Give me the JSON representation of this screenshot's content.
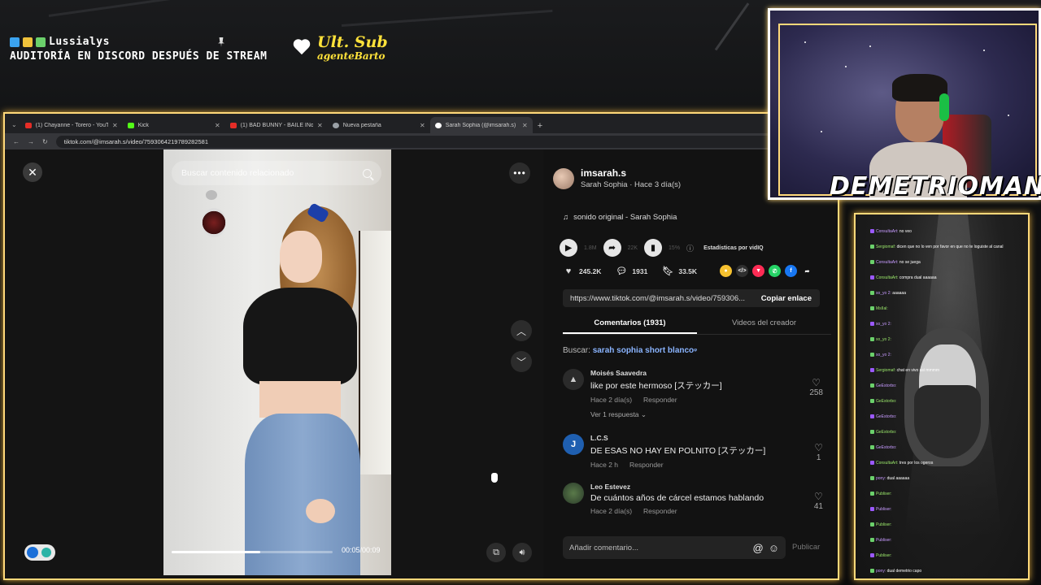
{
  "overlay": {
    "user_line": "Lussialys",
    "announcement": "AUDITORÍA EN DISCORD DESPUÉS DE STREAM",
    "last_sub_title": "Ult. Sub",
    "last_sub_name": "agenteBarto"
  },
  "browser": {
    "tabs": [
      {
        "label": "(1) Chayanne - Torero - YouTube",
        "color": "#e52d27"
      },
      {
        "label": "Kick",
        "color": "#53fc18"
      },
      {
        "label": "(1) BAD BUNNY - BAILE INoLVI...",
        "color": "#e52d27"
      },
      {
        "label": "Nueva pestaña",
        "color": "#9aa0a6"
      },
      {
        "label": "Sarah Sophia (@imsarah.s)",
        "color": "#ffffff"
      }
    ],
    "url": "tiktok.com/@imsarah.s/video/7593064219789282581"
  },
  "video": {
    "search_placeholder": "Buscar contenido relacionado",
    "timecode": "00:05/00:09",
    "progress": 0.55
  },
  "creator": {
    "handle": "imsarah.s",
    "subtitle": "Sarah Sophia · Hace 3 día(s)",
    "music": "sonido original - Sarah Sophia"
  },
  "stats": {
    "views": "1.8M",
    "shares_small": "22K",
    "pct": "15%",
    "vidiq": "Estadísticas por vidIQ",
    "likes": "245.2K",
    "comments": "1931",
    "saves": "33.5K"
  },
  "link": {
    "url": "https://www.tiktok.com/@imsarah.s/video/759306...",
    "copy_label": "Copiar enlace"
  },
  "tabs": {
    "comments": "Comentarios (1931)",
    "creator_videos": "Videos del creador"
  },
  "search": {
    "prefix": "Buscar:",
    "keyword": "sarah sophia short blanco"
  },
  "comments": [
    {
      "name": "Moisés Saavedra",
      "text": "like por este hermoso [ステッカー]",
      "time": "Hace 2 día(s)",
      "reply": "Responder",
      "likes": "258",
      "more": "Ver 1 respuesta"
    },
    {
      "name": "L.C.S",
      "text": "DE ESAS NO HAY EN POLNITO [ステッカー]",
      "time": "Hace 2 h",
      "reply": "Responder",
      "likes": "1",
      "initial": "J"
    },
    {
      "name": "Leo Estevez",
      "text": "De cuántos años de cárcel estamos hablando",
      "time": "Hace 2 día(s)",
      "reply": "Responder",
      "likes": "41"
    }
  ],
  "add_comment": {
    "placeholder": "Añadir comentario...",
    "publish": "Publicar"
  },
  "webcam": {
    "name": "DEMETRIOMAN",
    "suffix": "...."
  },
  "chat": [
    {
      "user": "ConsultaArt:",
      "msg": "no veo"
    },
    {
      "user": "Sergiomaf:",
      "msg": "dicen que no lo ven por favor en que no te loguiste al canal"
    },
    {
      "user": "ConsultaArt:",
      "msg": "no se juega"
    },
    {
      "user": "ConsultaArt:",
      "msg": "compra dual aaaaaa"
    },
    {
      "user": "so_yo 2:",
      "msg": "aaaaaa"
    },
    {
      "user": "MsIIal:",
      "msg": ""
    },
    {
      "user": "so_yo 2:",
      "msg": ""
    },
    {
      "user": "so_yo 2:",
      "msg": ""
    },
    {
      "user": "so_yo 2:",
      "msg": ""
    },
    {
      "user": "Sergiomaf:",
      "msg": "chat en vivo asi mmmm"
    },
    {
      "user": "GeEstorbo:",
      "msg": ""
    },
    {
      "user": "GeEstorbo:",
      "msg": ""
    },
    {
      "user": "GeEstorbo:",
      "msg": ""
    },
    {
      "user": "GeEstorbo:",
      "msg": ""
    },
    {
      "user": "GeEstorbo:",
      "msg": ""
    },
    {
      "user": "ConsultaArt:",
      "msg": "tres por los ogeros"
    },
    {
      "user": "pony:",
      "msg": "dual aaaaaa"
    },
    {
      "user": "Publiser:",
      "msg": ""
    },
    {
      "user": "Publiser:",
      "msg": ""
    },
    {
      "user": "Publiser:",
      "msg": ""
    },
    {
      "user": "Publiser:",
      "msg": ""
    },
    {
      "user": "Publiser:",
      "msg": ""
    },
    {
      "user": "pony:",
      "msg": "dual demetrio capo"
    }
  ]
}
